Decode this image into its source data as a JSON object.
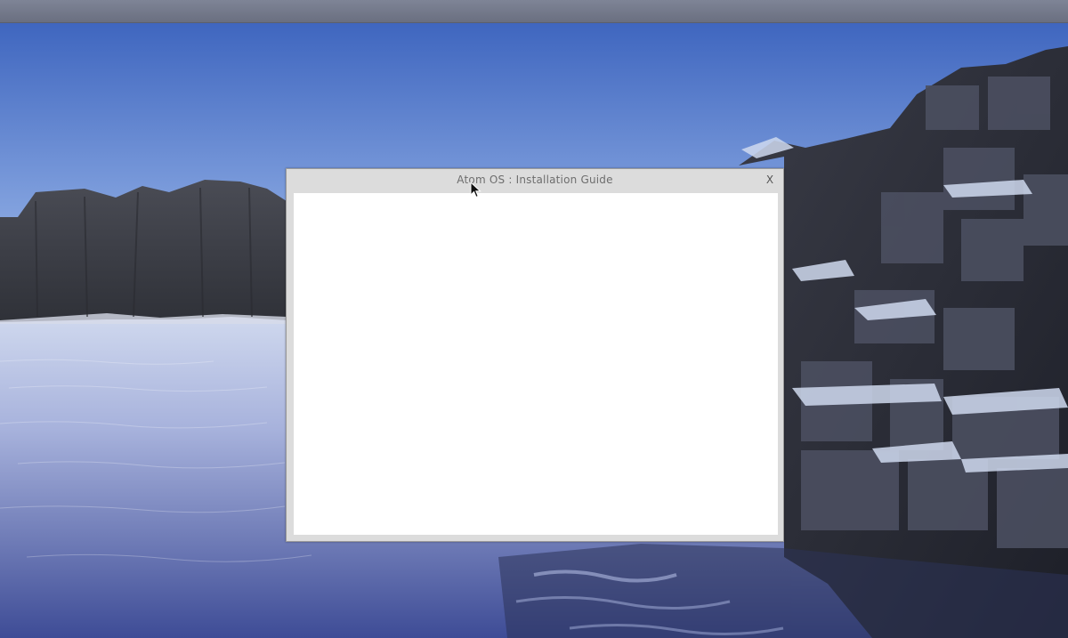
{
  "window": {
    "title": "Atom OS : Installation Guide",
    "close_label": "X"
  },
  "colors": {
    "sky_top": "#4a6fc0",
    "sky_bottom": "#9cb6e4",
    "water": "#9aa6d4",
    "window_frame": "#dcdcdc",
    "content_bg": "#ffffff"
  }
}
